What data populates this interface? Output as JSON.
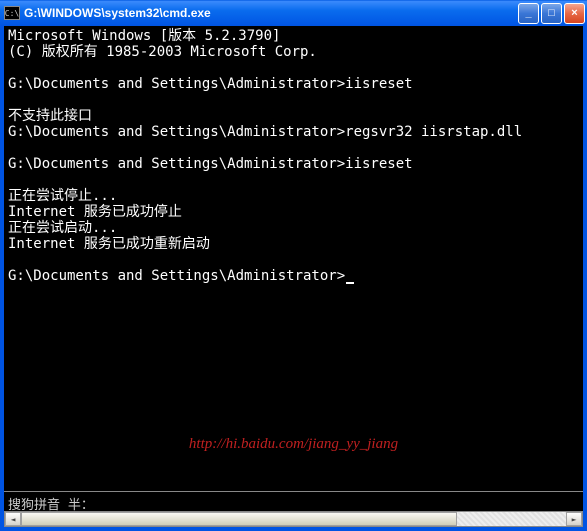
{
  "title_bar": {
    "icon_text": "C:\\",
    "title": "G:\\WINDOWS\\system32\\cmd.exe",
    "min_label": "_",
    "max_label": "□",
    "close_label": "×"
  },
  "terminal_lines": [
    "Microsoft Windows [版本 5.2.3790]",
    "(C) 版权所有 1985-2003 Microsoft Corp.",
    "",
    "G:\\Documents and Settings\\Administrator>iisreset",
    "",
    "不支持此接口",
    "G:\\Documents and Settings\\Administrator>regsvr32 iisrstap.dll",
    "",
    "G:\\Documents and Settings\\Administrator>iisreset",
    "",
    "正在尝试停止...",
    "Internet 服务已成功停止",
    "正在尝试启动...",
    "Internet 服务已成功重新启动",
    "",
    "G:\\Documents and Settings\\Administrator>"
  ],
  "cursor_visible": true,
  "watermark": "http://hi.baidu.com/jiang_yy_jiang",
  "ime_status": "搜狗拼音 半："
}
